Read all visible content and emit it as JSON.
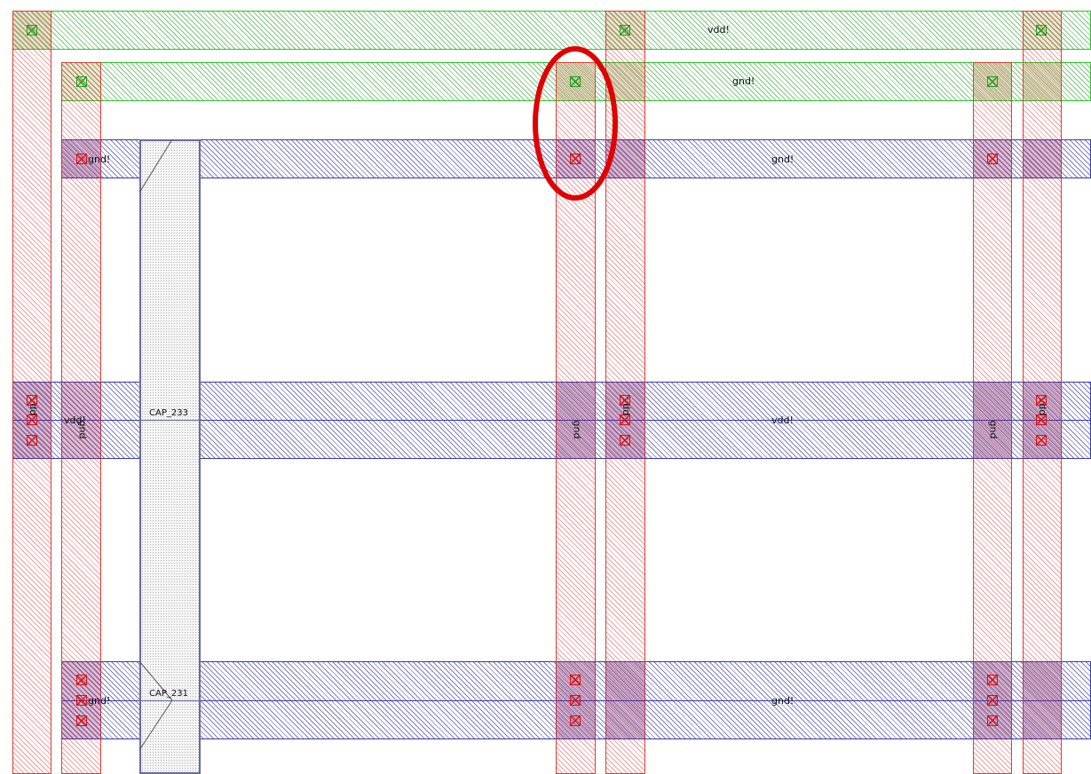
{
  "net_labels": {
    "top_vdd": "vdd!",
    "top_gnd": "gnd!",
    "row1_left": "gnd!",
    "row1_mid": "gnd!",
    "row2_left_vdd": "vdd!",
    "row2_mid": "vdd!",
    "row3_left": "gnd!",
    "row3_mid": "gnd!",
    "vert_gnd_1": "gnd",
    "vert_gnd_2": "gnd",
    "vert_gnd_3": "gnd",
    "vert_vdd_1": "vdd",
    "vert_vdd_2": "vdd",
    "vert_vdd_3": "vdd"
  },
  "cap_labels": {
    "cap_top": "CAP_233",
    "cap_bottom": "CAP_231"
  },
  "colors": {
    "metal_top": "#2fbf2f",
    "metal_horizontal": "#3a3aa8",
    "metal_vertical": "#e03a3a",
    "via_green": "#22a022",
    "via_red": "#e01010",
    "highlight": "#e00000"
  },
  "icons": {
    "via": "via-cross-icon",
    "highlight": "highlight-ellipse-icon"
  }
}
